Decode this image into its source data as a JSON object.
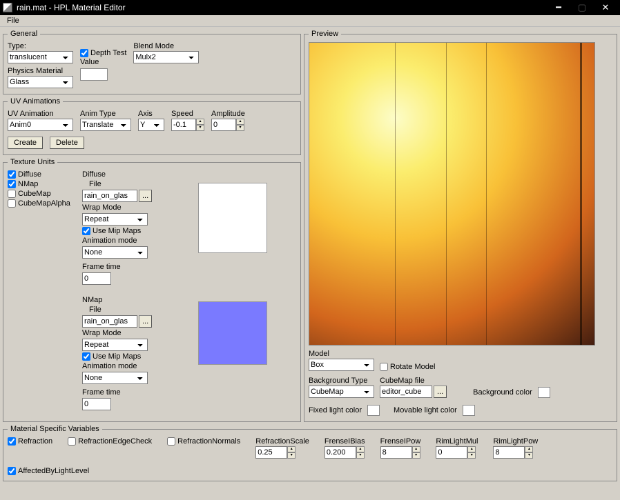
{
  "titlebar": {
    "text": "rain.mat - HPL Material Editor"
  },
  "menu": {
    "file": "File"
  },
  "general": {
    "legend": "General",
    "type_label": "Type:",
    "type_value": "translucent",
    "physmat_label": "Physics Material",
    "physmat_value": "Glass",
    "depth_label": "Depth Test",
    "value_label": "Value",
    "blend_label": "Blend Mode",
    "blend_value": "Mulx2"
  },
  "uvanim": {
    "legend": "UV Animations",
    "uvanim_label": "UV Animation",
    "uvanim_value": "Anim0",
    "animtype_label": "Anim Type",
    "animtype_value": "Translate",
    "axis_label": "Axis",
    "axis_value": "Y",
    "speed_label": "Speed",
    "speed_value": "-0.1",
    "amplitude_label": "Amplitude",
    "amplitude_value": "0",
    "create": "Create",
    "delete": "Delete"
  },
  "texunits": {
    "legend": "Texture Units",
    "checks": {
      "diffuse": "Diffuse",
      "nmap": "NMap",
      "cubemap": "CubeMap",
      "cubemapalpha": "CubeMapAlpha"
    },
    "diffuse": {
      "title": "Diffuse",
      "file_label": "File",
      "file_value": "rain_on_glas",
      "wrap_label": "Wrap Mode",
      "wrap_value": "Repeat",
      "mip_label": "Use Mip Maps",
      "animmode_label": "Animation mode",
      "animmode_value": "None",
      "frametime_label": "Frame time",
      "frametime_value": "0"
    },
    "nmap": {
      "title": "NMap",
      "file_label": "File",
      "file_value": "rain_on_glas",
      "wrap_label": "Wrap Mode",
      "wrap_value": "Repeat",
      "mip_label": "Use Mip Maps",
      "animmode_label": "Animation mode",
      "animmode_value": "None",
      "frametime_label": "Frame time",
      "frametime_value": "0"
    }
  },
  "preview": {
    "legend": "Preview",
    "model_label": "Model",
    "model_value": "Box",
    "rotate_label": "Rotate Model",
    "bgtype_label": "Background Type",
    "bgtype_value": "CubeMap",
    "cubefile_label": "CubeMap file",
    "cubefile_value": "editor_cube",
    "bgcolor_label": "Background color",
    "fixedlight_label": "Fixed light color",
    "movablelight_label": "Movable light color"
  },
  "matvars": {
    "legend": "Material Specific Variables",
    "refraction": "Refraction",
    "edgecheck": "RefractionEdgeCheck",
    "normals": "RefractionNormals",
    "refscale_label": "RefractionScale",
    "refscale_value": "0.25",
    "frenselbias_label": "FrenseIBias",
    "frenselbias_value": "0.200",
    "frenselpow_label": "FrenseIPow",
    "frenselpow_value": "8",
    "rimmul_label": "RimLightMul",
    "rimmul_value": "0",
    "rimpow_label": "RimLightPow",
    "rimpow_value": "8",
    "affected": "AffectedByLightLevel"
  }
}
